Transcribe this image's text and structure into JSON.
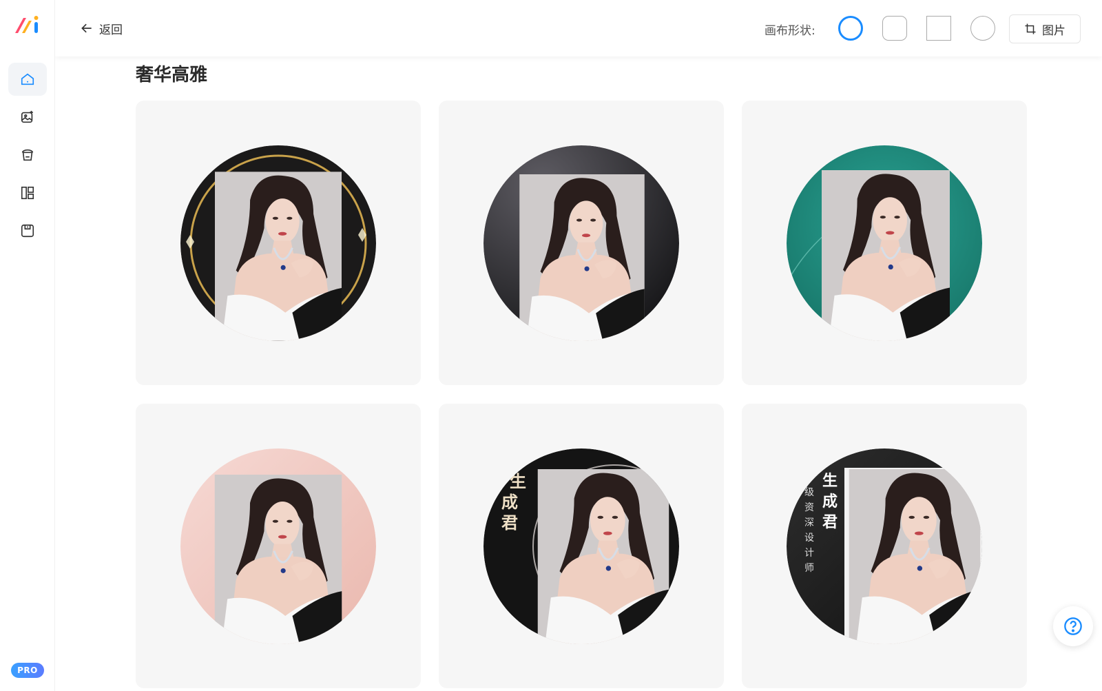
{
  "header": {
    "back_label": "返回",
    "shape_label": "画布形状:",
    "shapes": [
      "circle",
      "rounded-square",
      "square",
      "circle"
    ],
    "selected_shape": "circle",
    "image_button_label": "图片"
  },
  "sidebar": {
    "items": [
      "home-icon",
      "image-edit-icon",
      "bucket-icon",
      "layout-icon",
      "save-icon"
    ],
    "active": "home-icon",
    "pro_label": "PRO"
  },
  "section": {
    "title": "奢华高雅"
  },
  "templates": [
    {
      "style": "black-gold-ring",
      "overlay_text": []
    },
    {
      "style": "dark-gray",
      "overlay_text": []
    },
    {
      "style": "teal",
      "overlay_text": []
    },
    {
      "style": "pink",
      "overlay_text": []
    },
    {
      "style": "black-text",
      "overlay_text": [
        "生",
        "成",
        "君"
      ]
    },
    {
      "style": "black-text-vertical",
      "overlay_text": [
        "生",
        "成",
        "君"
      ],
      "sub_text": [
        "级",
        "资",
        "深",
        "设",
        "计",
        "师"
      ]
    }
  ],
  "colors": {
    "accent": "#1a8cff",
    "teal": "#1f8a7e",
    "pink": "#f2cfc9"
  }
}
